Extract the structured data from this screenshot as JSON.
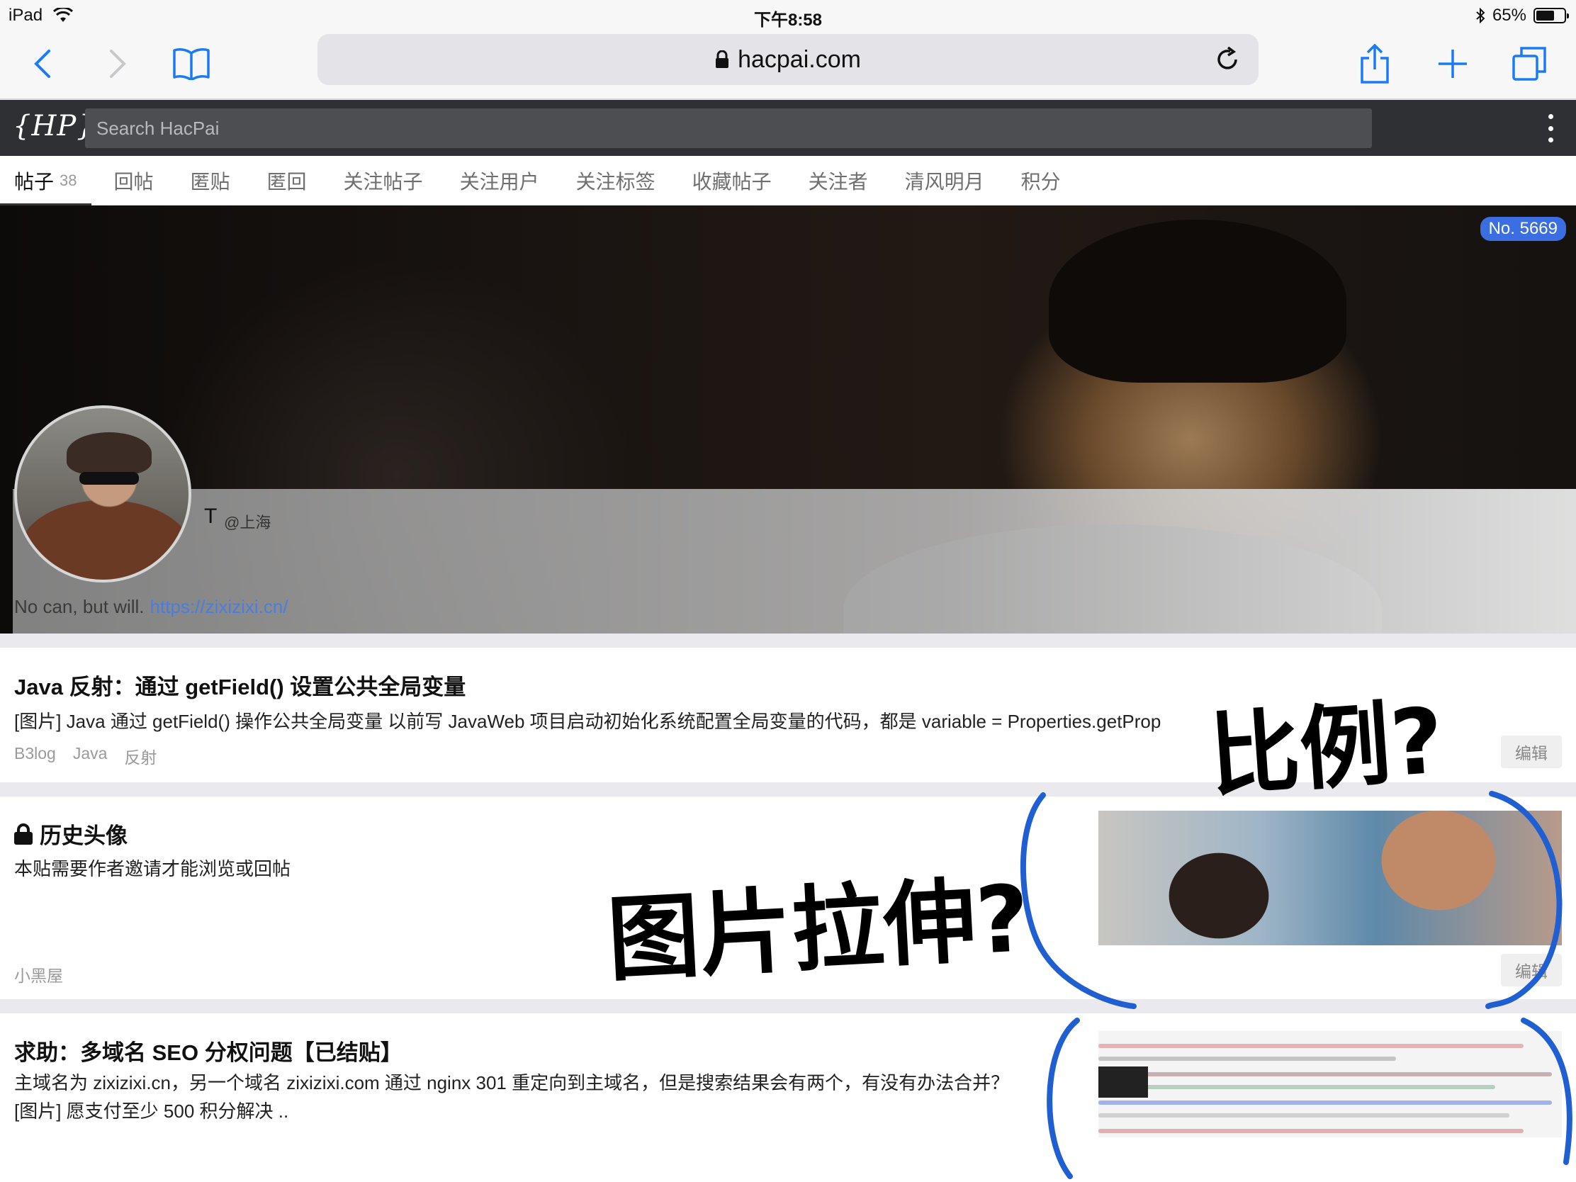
{
  "status_bar": {
    "device": "iPad",
    "time": "下午8:58",
    "battery": "65%",
    "battery_level": 0.65
  },
  "browser": {
    "url": "hacpai.com",
    "icons": [
      "back-icon",
      "forward-icon",
      "bookmarks-icon",
      "lock-icon",
      "reload-icon",
      "share-icon",
      "new-tab-icon",
      "tabs-icon"
    ]
  },
  "site": {
    "logo": "{HP}",
    "search_placeholder": "Search HacPai"
  },
  "tabs": [
    {
      "label": "帖子",
      "count": "38",
      "active": true
    },
    {
      "label": "回帖"
    },
    {
      "label": "匿贴"
    },
    {
      "label": "匿回"
    },
    {
      "label": "关注帖子"
    },
    {
      "label": "关注用户"
    },
    {
      "label": "关注标签"
    },
    {
      "label": "收藏帖子"
    },
    {
      "label": "关注者"
    },
    {
      "label": "清风明月"
    },
    {
      "label": "积分"
    }
  ],
  "profile": {
    "number_badge": "No. 5669",
    "username": "T",
    "location": "@上海",
    "bio_text": "No can, but will.",
    "bio_link": "https://zixizixi.cn/"
  },
  "posts": [
    {
      "title": "Java 反射：通过 getField() 设置公共全局变量",
      "excerpt": "[图片] Java 通过 getField() 操作公共全局变量 以前写 JavaWeb 项目启动初始化系统配置全局变量的代码，都是 variable = Properties.getProp",
      "tags": [
        "B3log",
        "Java",
        "反射"
      ],
      "edit": "编辑"
    },
    {
      "title": "历史头像",
      "locked": true,
      "excerpt": "本贴需要作者邀请才能浏览或回帖",
      "tags": [
        "小黑屋"
      ],
      "edit": "编辑"
    },
    {
      "title": "求助：多域名 SEO 分权问题【已结贴】",
      "excerpt_line1": "主域名为 zixizixi.cn，另一个域名 zixizixi.com 通过 nginx 301 重定向到主域名，但是搜索结果会有两个，有没有办法合并？",
      "excerpt_line2": "[图片] 愿支付至少 500 积分解决 .."
    }
  ],
  "annotations": {
    "note_ratio": "比例?",
    "note_stretch": "图片拉伸?"
  },
  "colors": {
    "accent_blue": "#3b6ee0",
    "header_dark": "#2f3033",
    "ink_blue": "#1f5fd1"
  }
}
